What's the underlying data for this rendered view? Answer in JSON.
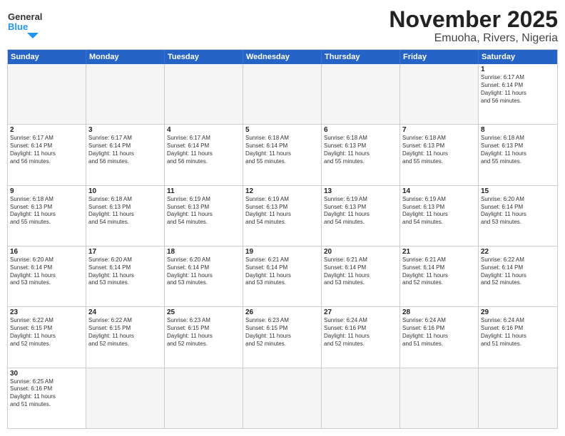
{
  "header": {
    "logo_general": "General",
    "logo_blue": "Blue",
    "title": "November 2025",
    "subtitle": "Emuoha, Rivers, Nigeria"
  },
  "days": [
    "Sunday",
    "Monday",
    "Tuesday",
    "Wednesday",
    "Thursday",
    "Friday",
    "Saturday"
  ],
  "rows": [
    [
      {
        "num": "",
        "info": ""
      },
      {
        "num": "",
        "info": ""
      },
      {
        "num": "",
        "info": ""
      },
      {
        "num": "",
        "info": ""
      },
      {
        "num": "",
        "info": ""
      },
      {
        "num": "",
        "info": ""
      },
      {
        "num": "1",
        "info": "Sunrise: 6:17 AM\nSunset: 6:14 PM\nDaylight: 11 hours\nand 56 minutes."
      }
    ],
    [
      {
        "num": "2",
        "info": "Sunrise: 6:17 AM\nSunset: 6:14 PM\nDaylight: 11 hours\nand 56 minutes."
      },
      {
        "num": "3",
        "info": "Sunrise: 6:17 AM\nSunset: 6:14 PM\nDaylight: 11 hours\nand 56 minutes."
      },
      {
        "num": "4",
        "info": "Sunrise: 6:17 AM\nSunset: 6:14 PM\nDaylight: 11 hours\nand 56 minutes."
      },
      {
        "num": "5",
        "info": "Sunrise: 6:18 AM\nSunset: 6:14 PM\nDaylight: 11 hours\nand 55 minutes."
      },
      {
        "num": "6",
        "info": "Sunrise: 6:18 AM\nSunset: 6:13 PM\nDaylight: 11 hours\nand 55 minutes."
      },
      {
        "num": "7",
        "info": "Sunrise: 6:18 AM\nSunset: 6:13 PM\nDaylight: 11 hours\nand 55 minutes."
      },
      {
        "num": "8",
        "info": "Sunrise: 6:18 AM\nSunset: 6:13 PM\nDaylight: 11 hours\nand 55 minutes."
      }
    ],
    [
      {
        "num": "9",
        "info": "Sunrise: 6:18 AM\nSunset: 6:13 PM\nDaylight: 11 hours\nand 55 minutes."
      },
      {
        "num": "10",
        "info": "Sunrise: 6:18 AM\nSunset: 6:13 PM\nDaylight: 11 hours\nand 54 minutes."
      },
      {
        "num": "11",
        "info": "Sunrise: 6:19 AM\nSunset: 6:13 PM\nDaylight: 11 hours\nand 54 minutes."
      },
      {
        "num": "12",
        "info": "Sunrise: 6:19 AM\nSunset: 6:13 PM\nDaylight: 11 hours\nand 54 minutes."
      },
      {
        "num": "13",
        "info": "Sunrise: 6:19 AM\nSunset: 6:13 PM\nDaylight: 11 hours\nand 54 minutes."
      },
      {
        "num": "14",
        "info": "Sunrise: 6:19 AM\nSunset: 6:13 PM\nDaylight: 11 hours\nand 54 minutes."
      },
      {
        "num": "15",
        "info": "Sunrise: 6:20 AM\nSunset: 6:14 PM\nDaylight: 11 hours\nand 53 minutes."
      }
    ],
    [
      {
        "num": "16",
        "info": "Sunrise: 6:20 AM\nSunset: 6:14 PM\nDaylight: 11 hours\nand 53 minutes."
      },
      {
        "num": "17",
        "info": "Sunrise: 6:20 AM\nSunset: 6:14 PM\nDaylight: 11 hours\nand 53 minutes."
      },
      {
        "num": "18",
        "info": "Sunrise: 6:20 AM\nSunset: 6:14 PM\nDaylight: 11 hours\nand 53 minutes."
      },
      {
        "num": "19",
        "info": "Sunrise: 6:21 AM\nSunset: 6:14 PM\nDaylight: 11 hours\nand 53 minutes."
      },
      {
        "num": "20",
        "info": "Sunrise: 6:21 AM\nSunset: 6:14 PM\nDaylight: 11 hours\nand 53 minutes."
      },
      {
        "num": "21",
        "info": "Sunrise: 6:21 AM\nSunset: 6:14 PM\nDaylight: 11 hours\nand 52 minutes."
      },
      {
        "num": "22",
        "info": "Sunrise: 6:22 AM\nSunset: 6:14 PM\nDaylight: 11 hours\nand 52 minutes."
      }
    ],
    [
      {
        "num": "23",
        "info": "Sunrise: 6:22 AM\nSunset: 6:15 PM\nDaylight: 11 hours\nand 52 minutes."
      },
      {
        "num": "24",
        "info": "Sunrise: 6:22 AM\nSunset: 6:15 PM\nDaylight: 11 hours\nand 52 minutes."
      },
      {
        "num": "25",
        "info": "Sunrise: 6:23 AM\nSunset: 6:15 PM\nDaylight: 11 hours\nand 52 minutes."
      },
      {
        "num": "26",
        "info": "Sunrise: 6:23 AM\nSunset: 6:15 PM\nDaylight: 11 hours\nand 52 minutes."
      },
      {
        "num": "27",
        "info": "Sunrise: 6:24 AM\nSunset: 6:16 PM\nDaylight: 11 hours\nand 52 minutes."
      },
      {
        "num": "28",
        "info": "Sunrise: 6:24 AM\nSunset: 6:16 PM\nDaylight: 11 hours\nand 51 minutes."
      },
      {
        "num": "29",
        "info": "Sunrise: 6:24 AM\nSunset: 6:16 PM\nDaylight: 11 hours\nand 51 minutes."
      }
    ],
    [
      {
        "num": "30",
        "info": "Sunrise: 6:25 AM\nSunset: 6:16 PM\nDaylight: 11 hours\nand 51 minutes."
      },
      {
        "num": "",
        "info": ""
      },
      {
        "num": "",
        "info": ""
      },
      {
        "num": "",
        "info": ""
      },
      {
        "num": "",
        "info": ""
      },
      {
        "num": "",
        "info": ""
      },
      {
        "num": "",
        "info": ""
      }
    ]
  ]
}
